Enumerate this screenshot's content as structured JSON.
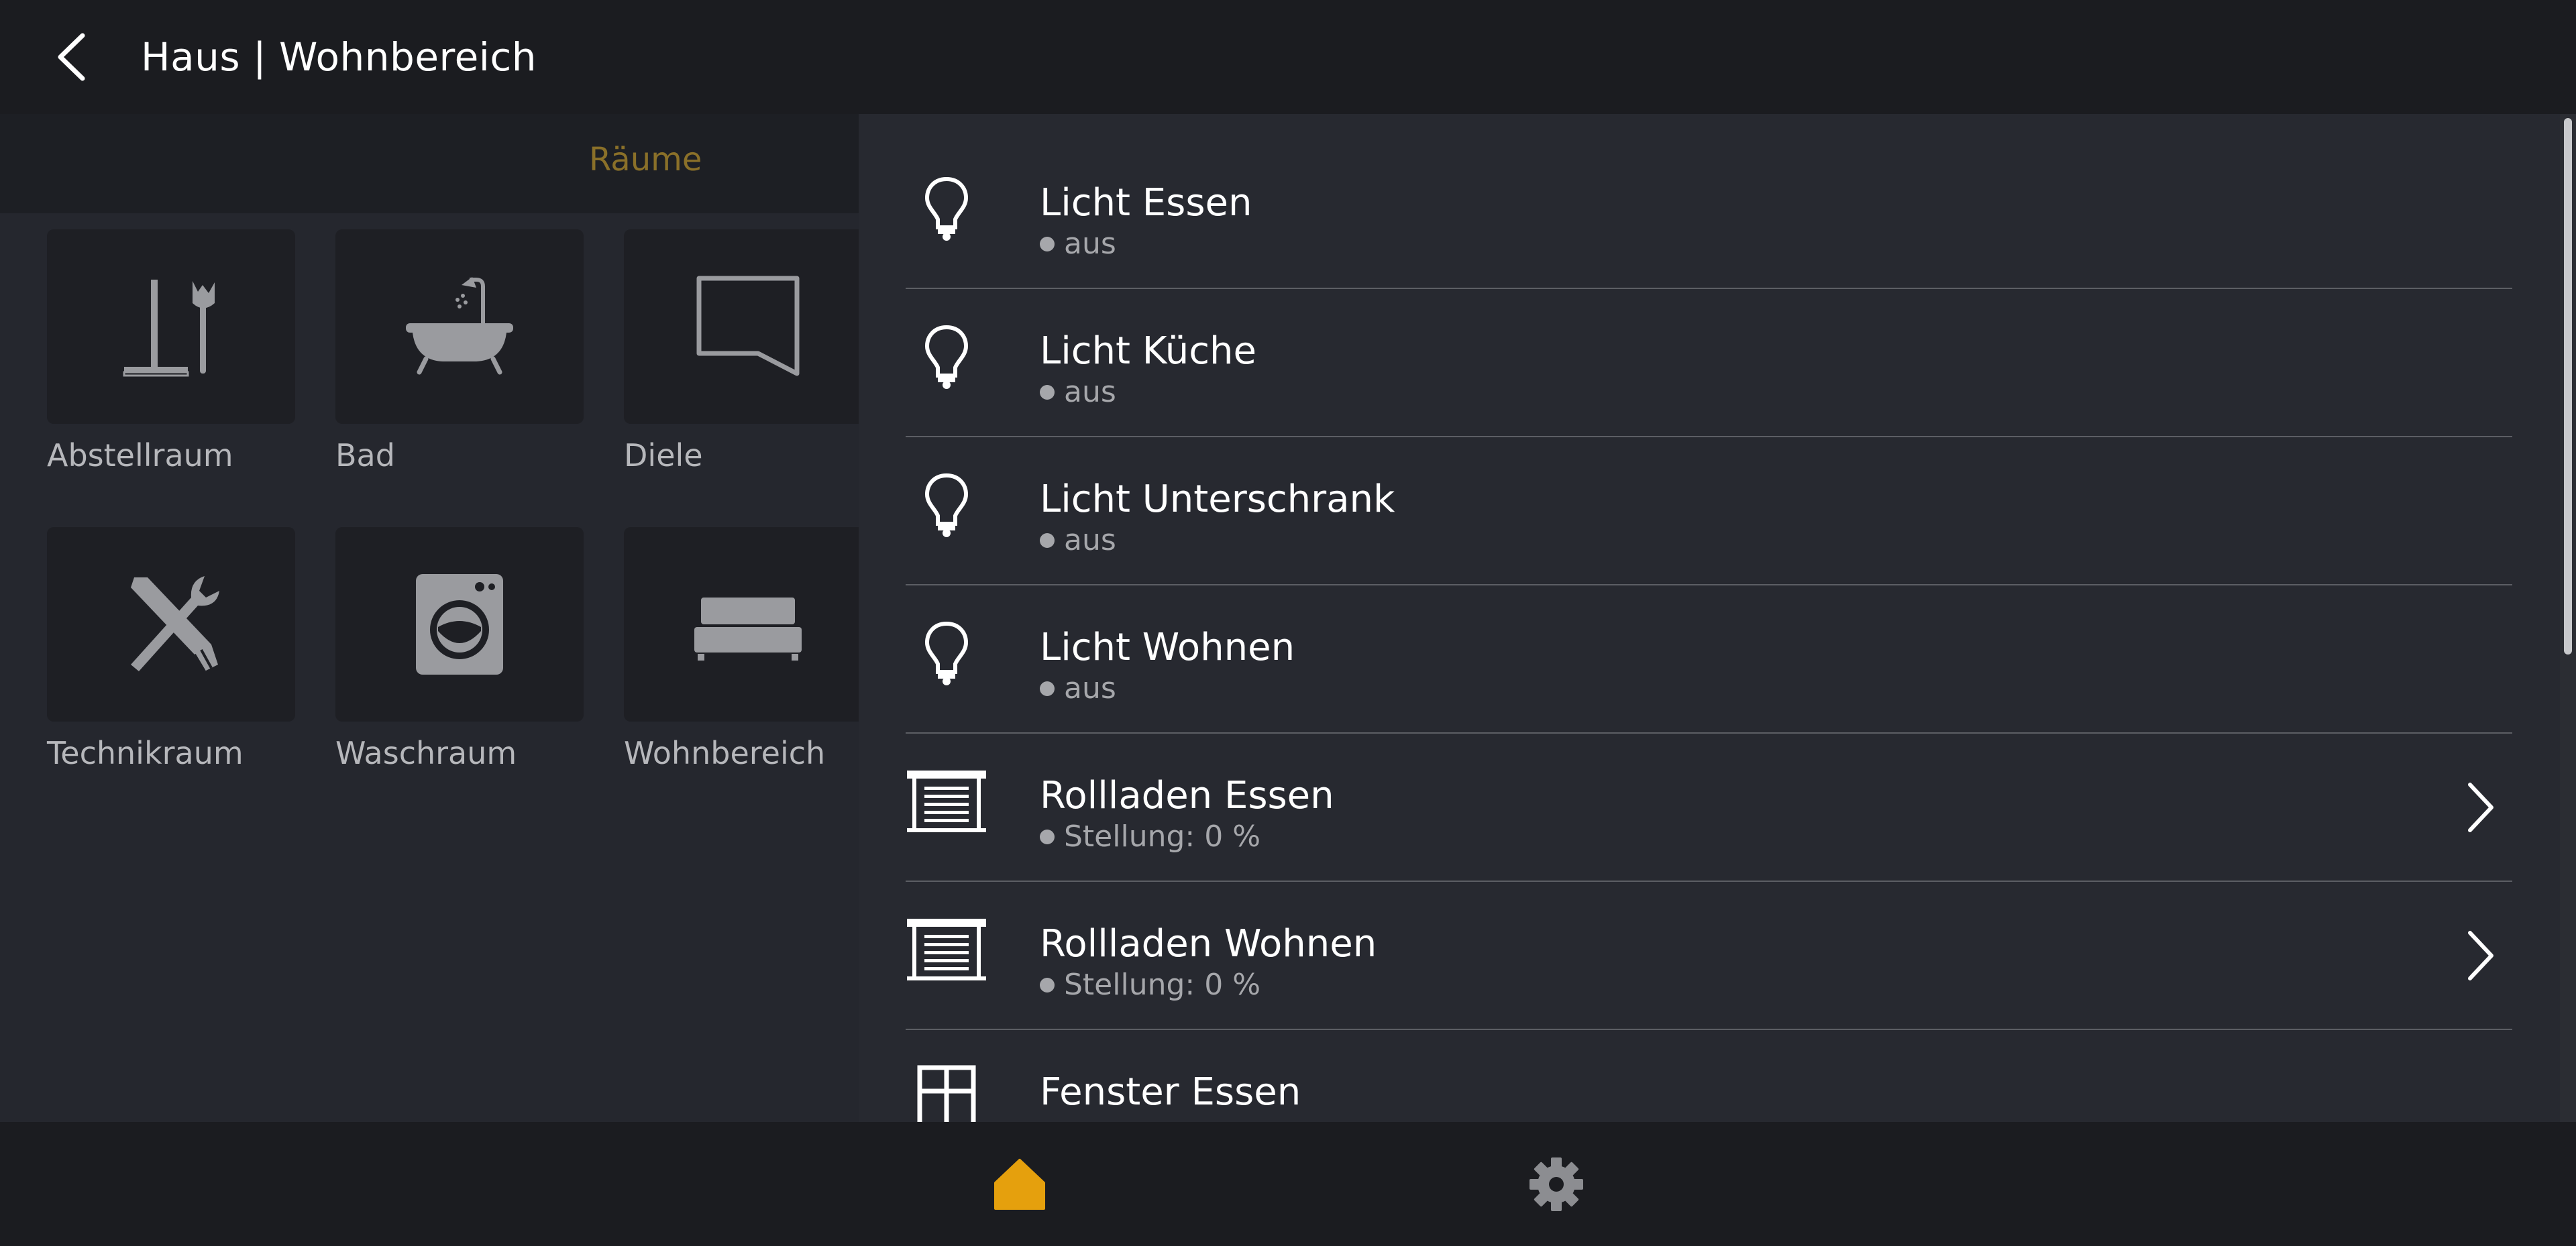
{
  "header": {
    "title": "Haus | Wohnbereich",
    "back_icon": "chevron-left-icon"
  },
  "tabs": {
    "active_label": "Räume",
    "active_color": "#8a7029"
  },
  "rooms": [
    {
      "label": "Abstellraum",
      "icon": "broom-mop-icon"
    },
    {
      "label": "Bad",
      "icon": "bathtub-icon"
    },
    {
      "label": "Diele",
      "icon": "hallway-icon"
    },
    {
      "label": "Technikraum",
      "icon": "tools-icon"
    },
    {
      "label": "Waschraum",
      "icon": "washing-machine-icon"
    },
    {
      "label": "Wohnbereich",
      "icon": "sofa-icon"
    }
  ],
  "devices": [
    {
      "name": "Licht Essen",
      "status": "aus",
      "icon": "lightbulb-icon"
    },
    {
      "name": "Licht Küche",
      "status": "aus",
      "icon": "lightbulb-icon"
    },
    {
      "name": "Licht Unterschrank",
      "status": "aus",
      "icon": "lightbulb-icon"
    },
    {
      "name": "Licht Wohnen",
      "status": "aus",
      "icon": "lightbulb-icon"
    },
    {
      "name": "Rollladen Essen",
      "status": "Stellung: 0 %",
      "icon": "roller-shutter-icon"
    },
    {
      "name": "Rollladen Wohnen",
      "status": "Stellung: 0 %",
      "icon": "roller-shutter-icon"
    },
    {
      "name": "Fenster Essen",
      "status": "",
      "icon": "window-icon"
    }
  ],
  "bottom_nav": {
    "home_icon": "home-icon",
    "home_color": "#e5a00d",
    "settings_icon": "gear-icon",
    "settings_color": "#8c8d91"
  }
}
